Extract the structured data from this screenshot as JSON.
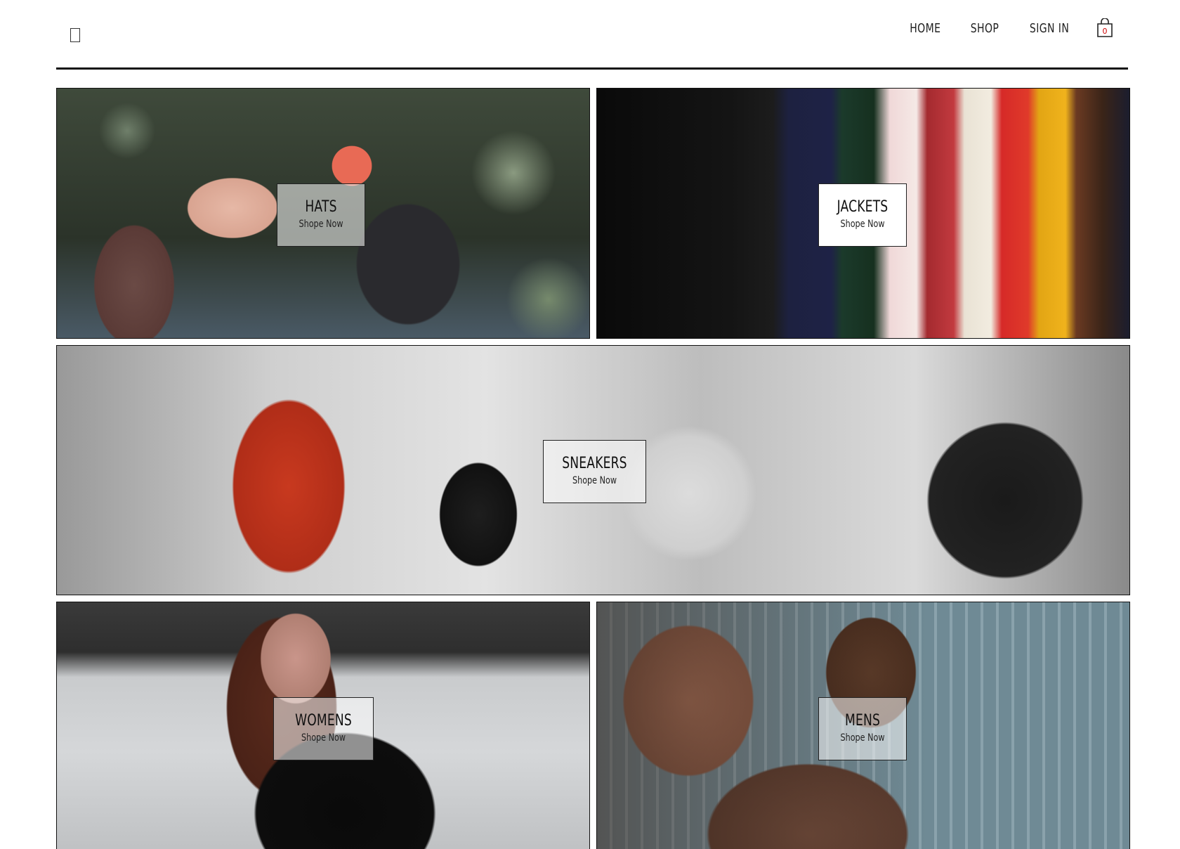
{
  "header": {
    "nav": [
      {
        "label": "HOME"
      },
      {
        "label": "SHOP"
      },
      {
        "label": "SIGN IN"
      }
    ],
    "cart": {
      "count": "0",
      "icon": "shopping-bag-icon"
    }
  },
  "categories": [
    {
      "title": "HATS",
      "cta": "Shope Now"
    },
    {
      "title": "JACKETS",
      "cta": "Shope Now"
    },
    {
      "title": "SNEAKERS",
      "cta": "Shope Now"
    },
    {
      "title": "WOMENS",
      "cta": "Shope Now"
    },
    {
      "title": "MENS",
      "cta": "Shope Now"
    }
  ]
}
